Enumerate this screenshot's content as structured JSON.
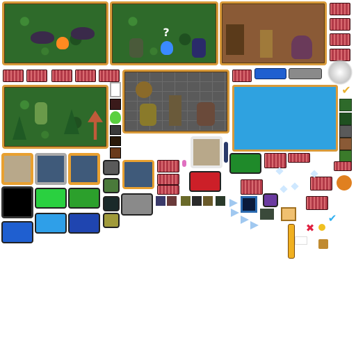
{
  "sheet": {
    "name": "",
    "colors": {
      "panel_border": "#d89a3a",
      "sky_blue": "#2fa2e0",
      "green": "#2ca02c",
      "red": "#cc1f28",
      "black": "#000000",
      "blue": "#1f5fd0",
      "gray": "#8a8a8a",
      "beige": "#b8a88a",
      "slate": "#3f5a7a",
      "olive": "#a09a3a",
      "purple": "#6a3aa0",
      "gold": "#e8b030"
    }
  },
  "scenes": {
    "bats": {
      "label": "",
      "icon": "bat-icon"
    },
    "wizard": {
      "symbol": "?"
    },
    "room": {
      "icon": "candelabra-icon"
    },
    "dungeon": {
      "icon": "candelabra-icon"
    }
  },
  "icons": {
    "checkmark": "✔",
    "cross": "✖",
    "lock": "🔒"
  }
}
